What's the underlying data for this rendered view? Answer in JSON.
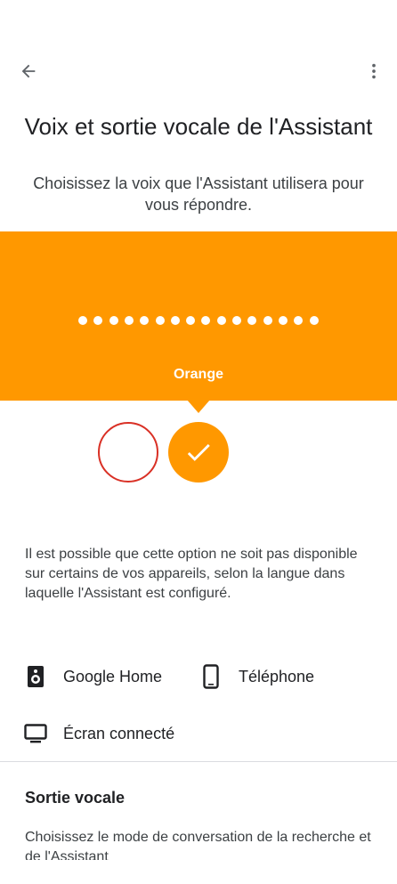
{
  "header": {
    "back_icon": "arrow-left-icon",
    "more_icon": "more-vert-icon",
    "title": "Voix et sortie vocale de l'Assistant"
  },
  "subtitle": "Choisissez la voix que l'Assistant utilisera pour vous répondre.",
  "voice_banner": {
    "color": "#ff9800",
    "dot_count": 16,
    "selected_voice_name": "Orange"
  },
  "voice_options": [
    {
      "id": "red",
      "color": "#d93025",
      "selected": false
    },
    {
      "id": "orange",
      "color": "#ff9800",
      "selected": true,
      "icon": "check-icon"
    }
  ],
  "info_text": "Il est possible que cette option ne soit pas disponible sur certains de vos appareils, selon la langue dans laquelle l'Assistant est configuré.",
  "devices": [
    {
      "icon": "speaker-icon",
      "label": "Google Home"
    },
    {
      "icon": "phone-icon",
      "label": "Téléphone"
    },
    {
      "icon": "monitor-icon",
      "label": "Écran connecté"
    }
  ],
  "voice_output": {
    "title": "Sortie vocale",
    "description": "Choisissez le mode de conversation de la recherche et de l'Assistant"
  }
}
